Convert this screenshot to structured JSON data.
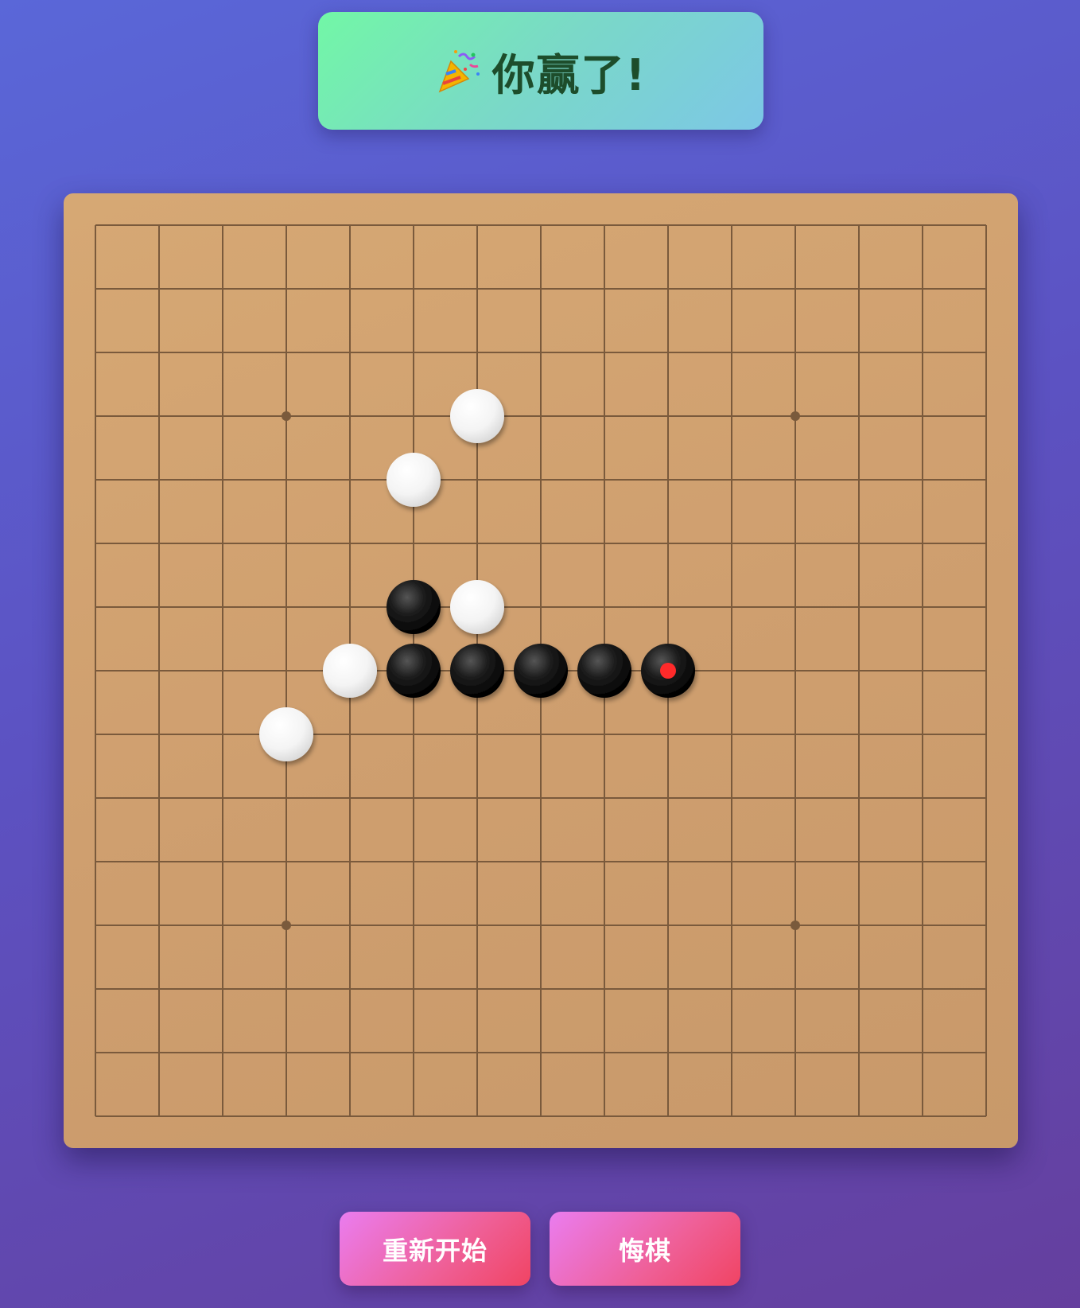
{
  "banner": {
    "icon": "party-popper-icon",
    "text": "你赢了!"
  },
  "board": {
    "size": 15,
    "star_points": [
      [
        3,
        3
      ],
      [
        3,
        11
      ],
      [
        11,
        3
      ],
      [
        11,
        11
      ]
    ],
    "stones": [
      {
        "row": 3,
        "col": 6,
        "color": "white"
      },
      {
        "row": 4,
        "col": 5,
        "color": "white"
      },
      {
        "row": 6,
        "col": 5,
        "color": "black"
      },
      {
        "row": 6,
        "col": 6,
        "color": "white"
      },
      {
        "row": 7,
        "col": 4,
        "color": "white"
      },
      {
        "row": 7,
        "col": 5,
        "color": "black"
      },
      {
        "row": 7,
        "col": 6,
        "color": "black"
      },
      {
        "row": 7,
        "col": 7,
        "color": "black"
      },
      {
        "row": 7,
        "col": 8,
        "color": "black"
      },
      {
        "row": 7,
        "col": 9,
        "color": "black",
        "last_move": true
      },
      {
        "row": 8,
        "col": 3,
        "color": "white"
      }
    ]
  },
  "controls": {
    "restart_label": "重新开始",
    "undo_label": "悔棋"
  },
  "colors": {
    "grid_line": "#7a5a3c",
    "last_move_marker": "#ff2a2a"
  }
}
